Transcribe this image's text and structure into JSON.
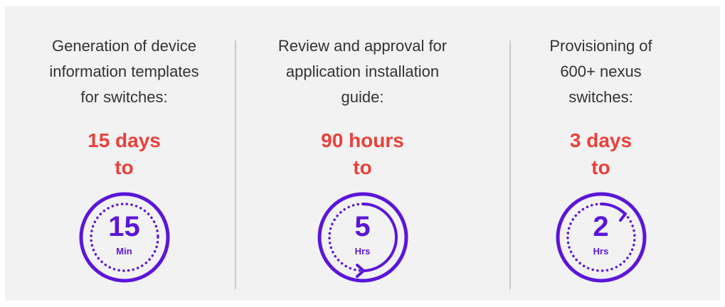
{
  "colors": {
    "background": "#f2f2f2",
    "text": "#333333",
    "highlight": "#e8413c",
    "accent": "#5b16d8",
    "divider": "#c9c9c9"
  },
  "columns": [
    {
      "description": "Generation of device\ninformation templates\nfor switches:",
      "before": "15 days",
      "connector": "to",
      "value": "15",
      "unit": "Min",
      "icon": "stopwatch-icon-full-dotted"
    },
    {
      "description": "Review and approval for\napplication installation\nguide:",
      "before": "90 hours",
      "connector": "to",
      "value": "5",
      "unit": "Hrs",
      "icon": "stopwatch-icon-half-arc"
    },
    {
      "description": "Provisioning of\n600+ nexus\nswitches:",
      "before": "3 days",
      "connector": "to",
      "value": "2",
      "unit": "Hrs",
      "icon": "stopwatch-icon-small-arc"
    }
  ]
}
